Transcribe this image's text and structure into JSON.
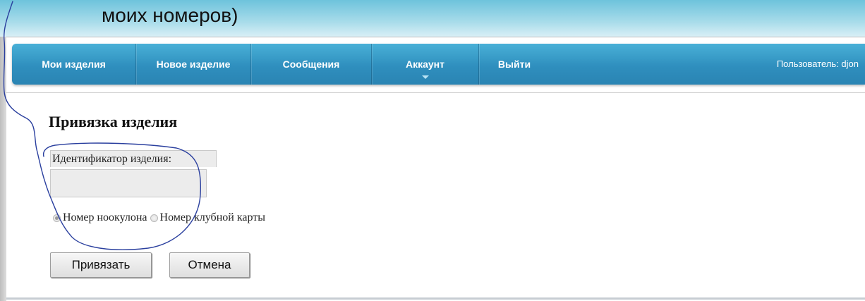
{
  "slide": {
    "top_text": "",
    "title": "моих номеров)"
  },
  "navbar": {
    "items": [
      {
        "label": "Мои изделия"
      },
      {
        "label": "Новое изделие"
      },
      {
        "label": "Сообщения"
      },
      {
        "label": "Аккаунт"
      },
      {
        "label": "Выйти"
      }
    ],
    "user_text": "Пользователь: djon"
  },
  "form": {
    "title": "Привязка изделия",
    "id_label": "Идентификатор изделия:",
    "id_value": "",
    "radio_options": [
      {
        "label": "Номер ноокулона",
        "checked": true
      },
      {
        "label": "Номер клубной карты",
        "checked": false
      }
    ],
    "submit_label": "Привязать",
    "cancel_label": "Отмена"
  },
  "colors": {
    "navbar_top": "#49b0d7",
    "navbar_bottom": "#2a84b3",
    "annotation_stroke": "#2a3f9e"
  }
}
